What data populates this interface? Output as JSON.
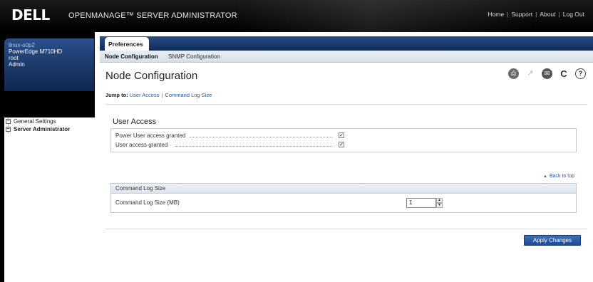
{
  "header": {
    "logo": "DELL",
    "app_title": "OPENMANAGE™ SERVER ADMINISTRATOR",
    "links": [
      "Home",
      "Support",
      "About",
      "Log Out"
    ]
  },
  "sidebar": {
    "host": {
      "hostname": "linux-o0p2",
      "model": "PowerEdge M710HD",
      "user": "root",
      "role": "Admin"
    },
    "tree": [
      {
        "label": "General Settings",
        "expander": "−"
      },
      {
        "label": "Server Administrator",
        "expander": "−"
      }
    ]
  },
  "tabs": {
    "main": "Preferences",
    "sub": [
      "Node Configuration",
      "SNMP Configuration"
    ]
  },
  "page": {
    "title": "Node Configuration",
    "jump_to_label": "Jump to:",
    "jump_links": [
      "User Access",
      "Command Log Size"
    ],
    "user_access": {
      "title": "User Access",
      "rows": [
        {
          "label": "Power User access granted",
          "checked": "✓"
        },
        {
          "label": "User access granted",
          "checked": "✓"
        }
      ]
    },
    "back_to_top": "Back to top",
    "command_log": {
      "header": "Command Log Size",
      "label": "Command Log Size (MB)",
      "value": "1"
    },
    "apply_label": "Apply Changes"
  },
  "icons": {
    "print": "print-icon",
    "export": "export-icon",
    "email": "email-icon",
    "refresh": "refresh-icon",
    "help": "help-icon"
  },
  "colors": {
    "header_bg": "#000000",
    "tab_blue": "#0c2a58",
    "link_blue": "#2a5aa8",
    "button_blue": "#1d4a93"
  }
}
